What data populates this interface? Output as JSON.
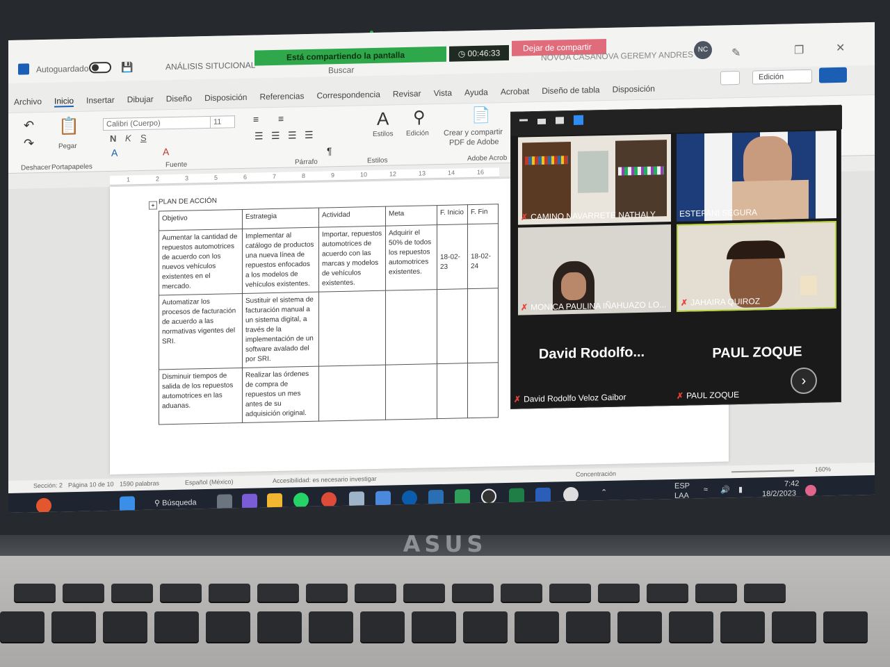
{
  "word": {
    "autosave_label": "Autoguardado",
    "doc_title": "ANÁLISIS SITUCIONAL",
    "search_placeholder": "Buscar",
    "user_name": "NOVOA CASANOVA GEREMY ANDRES",
    "user_initials": "NC",
    "edit_mode": "Edición",
    "menu": [
      "Archivo",
      "Inicio",
      "Insertar",
      "Dibujar",
      "Diseño",
      "Disposición",
      "Referencias",
      "Correspondencia",
      "Revisar",
      "Vista",
      "Ayuda",
      "Acrobat",
      "Diseño de tabla",
      "Disposición"
    ],
    "ribbon": {
      "undo_group": "Deshacer",
      "clipboard_group": "Portapapeles",
      "paste": "Pegar",
      "font_group": "Fuente",
      "paragraph_group": "Párrafo",
      "styles_group": "Estilos",
      "styles": "Estilos",
      "editing": "Edición",
      "adobe_create": "Crear y compartir",
      "adobe_pdf": "PDF de Adobe",
      "adobe_group": "Adobe Acrob",
      "font_name": "Calibri (Cuerpo)",
      "font_size": "11",
      "bold": "N",
      "italic": "K",
      "underline": "S"
    },
    "ruler_ticks": [
      "1",
      "2",
      "3",
      "5",
      "6",
      "7",
      "8",
      "9",
      "10",
      "12",
      "13",
      "14",
      "16"
    ],
    "document": {
      "heading": "PLAN DE ACCIÓN",
      "columns": [
        "Objetivo",
        "Estrategia",
        "Actividad",
        "Meta",
        "F. Inicio",
        "F. Fin"
      ],
      "rows": [
        {
          "objetivo": "Aumentar la cantidad de repuestos automotrices de acuerdo con los nuevos vehículos existentes en el mercado.",
          "estrategia": "Implementar al catálogo de productos una nueva línea de repuestos enfocados a los modelos de vehículos existentes.",
          "actividad": "Importar, repuestos automotrices de acuerdo con las marcas y modelos de vehículos existentes.",
          "meta": "Adquirir el 50% de todos los repuestos automotrices existentes.",
          "inicio": "18-02-23",
          "fin": "18-02-24"
        },
        {
          "objetivo": "Automatizar los procesos de facturación de acuerdo a las normativas vigentes del SRI.",
          "estrategia": "Sustituir el sistema de facturación manual a un sistema digital, a través de la implementación de un software avalado del por SRI.",
          "actividad": "",
          "meta": "",
          "inicio": "",
          "fin": ""
        },
        {
          "objetivo": "Disminuir tiempos de salida de los repuestos automotrices en las aduanas.",
          "estrategia": "Realizar las órdenes de compra de repuestos un mes antes de su adquisición original.",
          "actividad": "",
          "meta": "",
          "inicio": "",
          "fin": ""
        }
      ]
    },
    "status": {
      "section": "Sección: 2",
      "page": "Página 10 de 10",
      "words": "1590 palabras",
      "language": "Español (México)",
      "accessibility": "Accesibilidad: es necesario investigar",
      "focus": "Concentración",
      "zoom": "160%"
    }
  },
  "zoom": {
    "sharing_banner": "Está compartiendo la pantalla",
    "timer": "00:46:33",
    "stop_share": "Dejar de compartir",
    "participants": [
      {
        "name": "CAMINO NAVARRETE NATHALY"
      },
      {
        "name": "ESTEFANI SEGURA"
      },
      {
        "name": "MONICA PAULINA IÑAHUAZO LO..."
      },
      {
        "name": "JAHAIRA QUIROZ"
      },
      {
        "name": "David Rodolfo Veloz Gaibor",
        "display": "David  Rodolfo..."
      },
      {
        "name": "PAUL ZOQUE",
        "display": "PAUL ZOQUE"
      }
    ]
  },
  "taskbar": {
    "search": "Búsqueda",
    "lang": "ESP",
    "lang2": "LAA",
    "time": "7:42",
    "date": "18/2/2023"
  },
  "laptop": {
    "brand": "ASUS"
  },
  "colors": {
    "share_green": "#2ea84a",
    "stop_red": "#e06b7a",
    "word_blue": "#1a5fb4",
    "muted_mic": "#e8423a"
  }
}
